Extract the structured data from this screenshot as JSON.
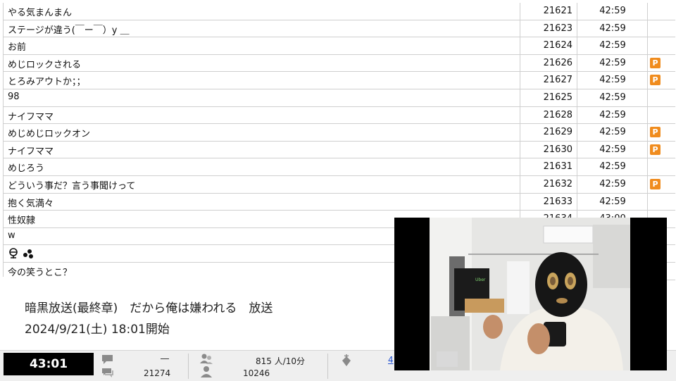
{
  "comments": [
    {
      "text": "やる気まんまん",
      "num": "21621",
      "time": "42:59",
      "premium": false
    },
    {
      "text": "ステージが違う(￣ー￣）y ＿",
      "num": "21623",
      "time": "42:59",
      "premium": false
    },
    {
      "text": "お前",
      "num": "21624",
      "time": "42:59",
      "premium": false
    },
    {
      "text": "めじロックされる",
      "num": "21626",
      "time": "42:59",
      "premium": true
    },
    {
      "text": "とろみアウトか；；",
      "num": "21627",
      "time": "42:59",
      "premium": true
    },
    {
      "text": "98",
      "num": "21625",
      "time": "42:59",
      "premium": false
    },
    {
      "text": "ナイフママ",
      "num": "21628",
      "time": "42:59",
      "premium": false
    },
    {
      "text": "めじめじロックオン",
      "num": "21629",
      "time": "42:59",
      "premium": true
    },
    {
      "text": "ナイフママ",
      "num": "21630",
      "time": "42:59",
      "premium": true
    },
    {
      "text": "めじろう",
      "num": "21631",
      "time": "42:59",
      "premium": false
    },
    {
      "text": "どういう事だ？言う事聞けって",
      "num": "21632",
      "time": "42:59",
      "premium": true
    },
    {
      "text": "抱く気満々",
      "num": "21633",
      "time": "42:59",
      "premium": false
    },
    {
      "text": "性奴隷",
      "num": "21634",
      "time": "43:00",
      "premium": false
    },
    {
      "text": "w",
      "num": "",
      "time": "",
      "premium": false
    },
    {
      "text": "",
      "num": "",
      "time": "",
      "premium": false
    },
    {
      "text": "今の笑うとこ？",
      "num": "",
      "time": "",
      "premium": false
    }
  ],
  "premium_badge": "P",
  "broadcast": {
    "title": "暗黒放送(最終章)　だから俺は嫌われる　放送",
    "start": "2024/9/21(土) 18:01開始"
  },
  "status": {
    "elapsed": "43:01",
    "stat1_top": "―",
    "stat1_bottom": "21274",
    "stat2_top": "815 人/10分",
    "stat2_bottom": "10246",
    "stat3_top": "4"
  },
  "colors": {
    "badge": "#f08c1e",
    "elapsed_bg": "#000000",
    "grid": "#cfcfcf"
  },
  "video_sign": "Uber"
}
